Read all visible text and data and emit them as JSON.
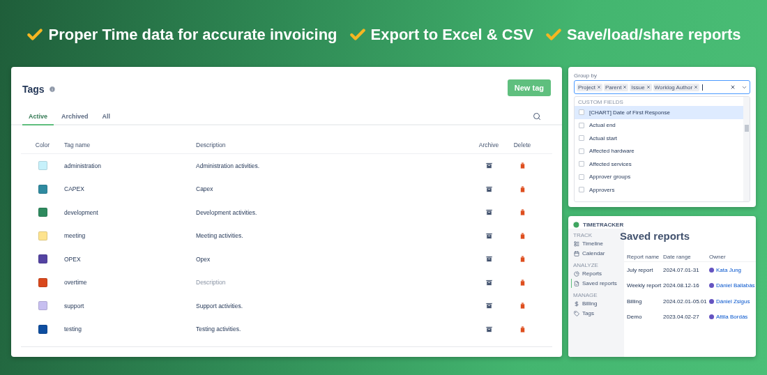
{
  "features": [
    {
      "text": "Proper Time data for accurate invoicing"
    },
    {
      "text": "Export to Excel & CSV"
    },
    {
      "text": "Save/load/share reports"
    }
  ],
  "tags_panel": {
    "title": "Tags",
    "new_tag_button": "New tag",
    "tabs": [
      {
        "label": "Active",
        "selected": true
      },
      {
        "label": "Archived",
        "selected": false
      },
      {
        "label": "All",
        "selected": false
      }
    ],
    "columns": [
      "Color",
      "Tag name",
      "Description",
      "Archive",
      "Delete"
    ],
    "rows": [
      {
        "color": "#c6f1fb",
        "name": "administration",
        "description": "Administration activities.",
        "placeholder": false
      },
      {
        "color": "#2f8aa0",
        "name": "CAPEX",
        "description": "Capex",
        "placeholder": false
      },
      {
        "color": "#2e8a5e",
        "name": "development",
        "description": "Development activities.",
        "placeholder": false
      },
      {
        "color": "#fde38e",
        "name": "meeting",
        "description": "Meeting activities.",
        "placeholder": false
      },
      {
        "color": "#5443a2",
        "name": "OPEX",
        "description": "Opex",
        "placeholder": false
      },
      {
        "color": "#d9481c",
        "name": "overtime",
        "description": "Description",
        "placeholder": true
      },
      {
        "color": "#c7bff0",
        "name": "support",
        "description": "Support activities.",
        "placeholder": false
      },
      {
        "color": "#0e4ea0",
        "name": "testing",
        "description": "Testing activities.",
        "placeholder": false
      }
    ]
  },
  "group_by": {
    "label": "Group by",
    "chips": [
      "Project",
      "Parent",
      "Issue",
      "Worklog Author"
    ],
    "section": "CUSTOM FIELDS",
    "options": [
      {
        "label": "[CHART] Date of First Response",
        "checked": false,
        "selected": true
      },
      {
        "label": "Actual end",
        "checked": false,
        "selected": false
      },
      {
        "label": "Actual start",
        "checked": false,
        "selected": false
      },
      {
        "label": "Affected hardware",
        "checked": false,
        "selected": false
      },
      {
        "label": "Affected services",
        "checked": false,
        "selected": false
      },
      {
        "label": "Approver groups",
        "checked": false,
        "selected": false
      },
      {
        "label": "Approvers",
        "checked": false,
        "selected": false
      }
    ]
  },
  "saved_reports": {
    "brand": "TIMETRACKER",
    "sidebar": [
      {
        "section": "TRACK",
        "items": [
          {
            "label": "Timeline",
            "selected": false
          },
          {
            "label": "Calendar",
            "selected": false
          }
        ]
      },
      {
        "section": "ANALYZE",
        "items": [
          {
            "label": "Reports",
            "selected": false
          },
          {
            "label": "Saved reports",
            "selected": true
          }
        ]
      },
      {
        "section": "MANAGE",
        "items": [
          {
            "label": "Billing",
            "selected": false
          },
          {
            "label": "Tags",
            "selected": false
          }
        ]
      }
    ],
    "title": "Saved reports",
    "columns": [
      "Report name",
      "Date range",
      "Owner"
    ],
    "rows": [
      {
        "name": "July report",
        "date_range": "2024.07.01-31",
        "owner": "Kata Jung"
      },
      {
        "name": "Weekly report",
        "date_range": "2024.08.12-16",
        "owner": "Dániel Ballabás"
      },
      {
        "name": "Billing",
        "date_range": "2024.02.01-05.01",
        "owner": "Dániel Zsigus"
      },
      {
        "name": "Demo",
        "date_range": "2023.04.02-27",
        "owner": "Attila Bordás"
      }
    ]
  }
}
